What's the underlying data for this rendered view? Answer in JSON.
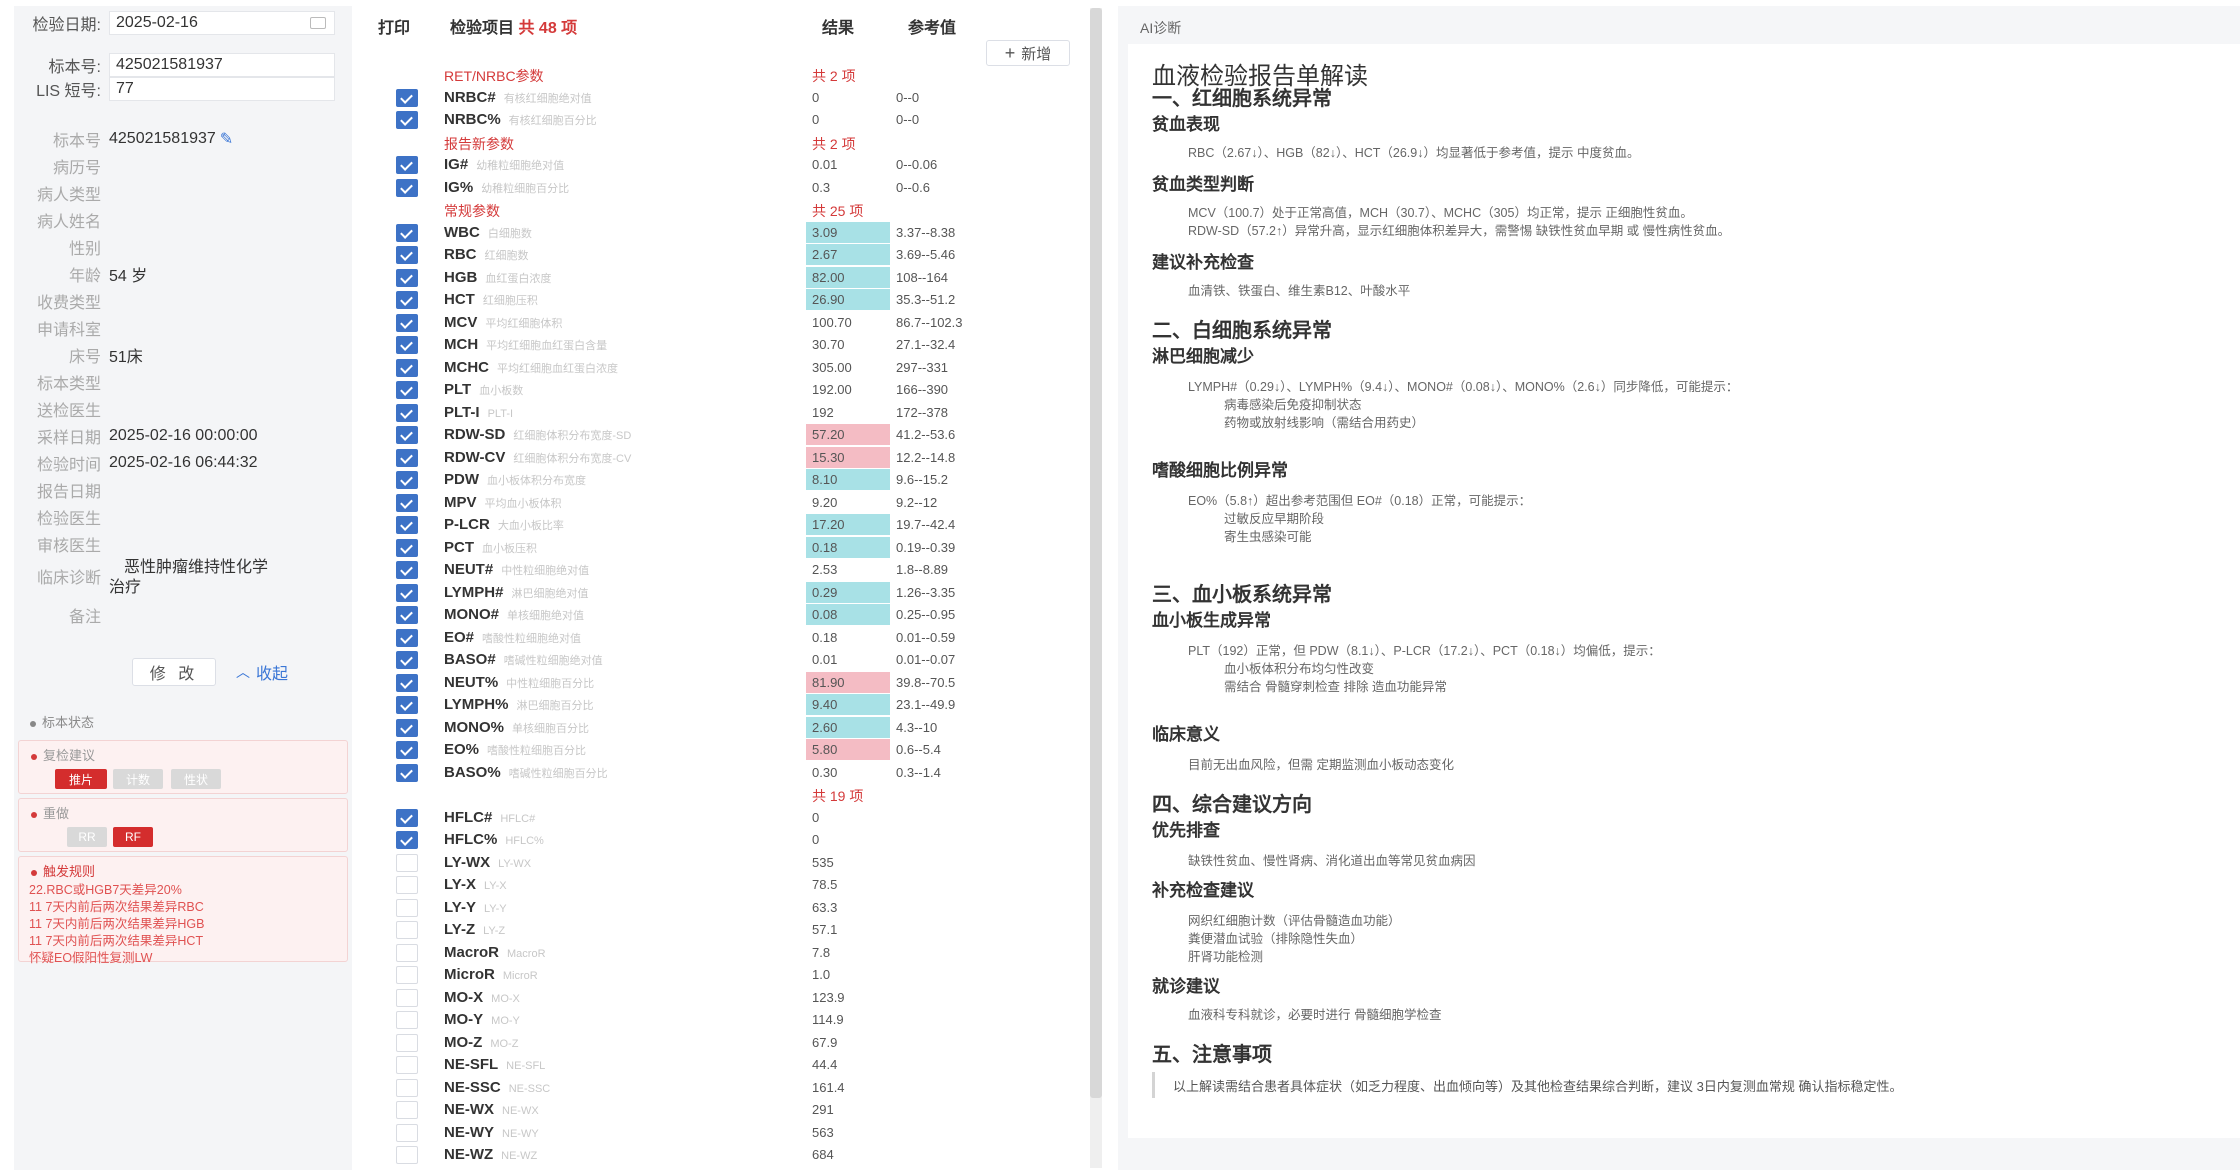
{
  "left": {
    "date_label": "检验日期:",
    "date_value": "2025-02-16",
    "sample_label": "标本号:",
    "sample_value": "425021581937",
    "lis_label": "LIS 短号:",
    "lis_value": "77",
    "info": [
      {
        "k": "标本号",
        "v": "425021581937",
        "pencil": true
      },
      {
        "k": "病历号",
        "v": ""
      },
      {
        "k": "病人类型",
        "v": ""
      },
      {
        "k": "病人姓名",
        "v": ""
      },
      {
        "k": "性别",
        "v": ""
      },
      {
        "k": "年龄",
        "v": "54 岁"
      },
      {
        "k": "收费类型",
        "v": ""
      },
      {
        "k": "申请科室",
        "v": ""
      },
      {
        "k": "床号",
        "v": "51床"
      },
      {
        "k": "标本类型",
        "v": ""
      },
      {
        "k": "送检医生",
        "v": ""
      },
      {
        "k": "采样日期",
        "v": "2025-02-16 00:00:00"
      },
      {
        "k": "检验时间",
        "v": "2025-02-16 06:44:32"
      },
      {
        "k": "报告日期",
        "v": ""
      },
      {
        "k": "检验医生",
        "v": ""
      },
      {
        "k": "审核医生",
        "v": ""
      }
    ],
    "diagnosis_label": "临床诊断",
    "diagnosis_value_1": "恶性肿瘤维持性化学",
    "diagnosis_value_2": "治疗",
    "remark_label": "备注",
    "edit_label": "修 改",
    "collapse_label": "收起",
    "status_title": "标本状态",
    "recheck_title": "复检建议",
    "recheck_tags": [
      "推片",
      "计数",
      "性状"
    ],
    "alarm_title": "重做",
    "alarm_tags": [
      "RR",
      "RF"
    ],
    "rule_title": "触发规则",
    "rules": [
      "22.RBC或HGB7天差异20%",
      "11 7天内前后两次结果差异RBC",
      "11 7天内前后两次结果差异HGB",
      "11 7天内前后两次结果差异HCT",
      "怀疑EO假阳性复测LW"
    ]
  },
  "middle": {
    "col_print": "打印",
    "col_item": "检验项目",
    "item_total": "共 48 项",
    "col_result": "结果",
    "col_ref": "参考值",
    "add_label": "新增",
    "rows": [
      {
        "type": "group",
        "name": "RET/NRBC参数",
        "count": "共 2 项"
      },
      {
        "code": "NRBC#",
        "cname": "有核红细胞绝对值",
        "res": "0",
        "ref": "0--0",
        "flag": "",
        "on": true
      },
      {
        "code": "NRBC%",
        "cname": "有核红细胞百分比",
        "res": "0",
        "ref": "0--0",
        "flag": "",
        "on": true
      },
      {
        "type": "group",
        "name": "报告新参数",
        "count": "共 2 项"
      },
      {
        "code": "IG#",
        "cname": "幼稚粒细胞绝对值",
        "res": "0.01",
        "ref": "0--0.06",
        "flag": "",
        "on": true
      },
      {
        "code": "IG%",
        "cname": "幼稚粒细胞百分比",
        "res": "0.3",
        "ref": "0--0.6",
        "flag": "",
        "on": true
      },
      {
        "type": "group",
        "name": "常规参数",
        "count": "共 25 项"
      },
      {
        "code": "WBC",
        "cname": "白细胞数",
        "res": "3.09",
        "ref": "3.37--8.38",
        "flag": "low",
        "on": true
      },
      {
        "code": "RBC",
        "cname": "红细胞数",
        "res": "2.67",
        "ref": "3.69--5.46",
        "flag": "low",
        "on": true
      },
      {
        "code": "HGB",
        "cname": "血红蛋白浓度",
        "res": "82.00",
        "ref": "108--164",
        "flag": "low",
        "on": true
      },
      {
        "code": "HCT",
        "cname": "红细胞压积",
        "res": "26.90",
        "ref": "35.3--51.2",
        "flag": "low",
        "on": true
      },
      {
        "code": "MCV",
        "cname": "平均红细胞体积",
        "res": "100.70",
        "ref": "86.7--102.3",
        "flag": "",
        "on": true
      },
      {
        "code": "MCH",
        "cname": "平均红细胞血红蛋白含量",
        "res": "30.70",
        "ref": "27.1--32.4",
        "flag": "",
        "on": true
      },
      {
        "code": "MCHC",
        "cname": "平均红细胞血红蛋白浓度",
        "res": "305.00",
        "ref": "297--331",
        "flag": "",
        "on": true
      },
      {
        "code": "PLT",
        "cname": "血小板数",
        "res": "192.00",
        "ref": "166--390",
        "flag": "",
        "on": true
      },
      {
        "code": "PLT-I",
        "cname": "PLT-I",
        "res": "192",
        "ref": "172--378",
        "flag": "",
        "on": true
      },
      {
        "code": "RDW-SD",
        "cname": "红细胞体积分布宽度-SD",
        "res": "57.20",
        "ref": "41.2--53.6",
        "flag": "high",
        "on": true
      },
      {
        "code": "RDW-CV",
        "cname": "红细胞体积分布宽度-CV",
        "res": "15.30",
        "ref": "12.2--14.8",
        "flag": "high",
        "on": true
      },
      {
        "code": "PDW",
        "cname": "血小板体积分布宽度",
        "res": "8.10",
        "ref": "9.6--15.2",
        "flag": "low",
        "on": true
      },
      {
        "code": "MPV",
        "cname": "平均血小板体积",
        "res": "9.20",
        "ref": "9.2--12",
        "flag": "",
        "on": true
      },
      {
        "code": "P-LCR",
        "cname": "大血小板比率",
        "res": "17.20",
        "ref": "19.7--42.4",
        "flag": "low",
        "on": true
      },
      {
        "code": "PCT",
        "cname": "血小板压积",
        "res": "0.18",
        "ref": "0.19--0.39",
        "flag": "low",
        "on": true
      },
      {
        "code": "NEUT#",
        "cname": "中性粒细胞绝对值",
        "res": "2.53",
        "ref": "1.8--8.89",
        "flag": "",
        "on": true
      },
      {
        "code": "LYMPH#",
        "cname": "淋巴细胞绝对值",
        "res": "0.29",
        "ref": "1.26--3.35",
        "flag": "low",
        "on": true
      },
      {
        "code": "MONO#",
        "cname": "单核细胞绝对值",
        "res": "0.08",
        "ref": "0.25--0.95",
        "flag": "low",
        "on": true
      },
      {
        "code": "EO#",
        "cname": "嗜酸性粒细胞绝对值",
        "res": "0.18",
        "ref": "0.01--0.59",
        "flag": "",
        "on": true
      },
      {
        "code": "BASO#",
        "cname": "嗜碱性粒细胞绝对值",
        "res": "0.01",
        "ref": "0.01--0.07",
        "flag": "",
        "on": true
      },
      {
        "code": "NEUT%",
        "cname": "中性粒细胞百分比",
        "res": "81.90",
        "ref": "39.8--70.5",
        "flag": "high",
        "on": true
      },
      {
        "code": "LYMPH%",
        "cname": "淋巴细胞百分比",
        "res": "9.40",
        "ref": "23.1--49.9",
        "flag": "low",
        "on": true
      },
      {
        "code": "MONO%",
        "cname": "单核细胞百分比",
        "res": "2.60",
        "ref": "4.3--10",
        "flag": "low",
        "on": true
      },
      {
        "code": "EO%",
        "cname": "嗜酸性粒细胞百分比",
        "res": "5.80",
        "ref": "0.6--5.4",
        "flag": "high",
        "on": true
      },
      {
        "code": "BASO%",
        "cname": "嗜碱性粒细胞百分比",
        "res": "0.30",
        "ref": "0.3--1.4",
        "flag": "",
        "on": true
      },
      {
        "type": "group",
        "name": "",
        "count": "共 19 项"
      },
      {
        "code": "HFLC#",
        "cname": "HFLC#",
        "res": "0",
        "ref": "",
        "flag": "",
        "on": true
      },
      {
        "code": "HFLC%",
        "cname": "HFLC%",
        "res": "0",
        "ref": "",
        "flag": "",
        "on": true
      },
      {
        "code": "LY-WX",
        "cname": "LY-WX",
        "res": "535",
        "ref": "",
        "flag": "",
        "on": false
      },
      {
        "code": "LY-X",
        "cname": "LY-X",
        "res": "78.5",
        "ref": "",
        "flag": "",
        "on": false
      },
      {
        "code": "LY-Y",
        "cname": "LY-Y",
        "res": "63.3",
        "ref": "",
        "flag": "",
        "on": false
      },
      {
        "code": "LY-Z",
        "cname": "LY-Z",
        "res": "57.1",
        "ref": "",
        "flag": "",
        "on": false
      },
      {
        "code": "MacroR",
        "cname": "MacroR",
        "res": "7.8",
        "ref": "",
        "flag": "",
        "on": false
      },
      {
        "code": "MicroR",
        "cname": "MicroR",
        "res": "1.0",
        "ref": "",
        "flag": "",
        "on": false
      },
      {
        "code": "MO-X",
        "cname": "MO-X",
        "res": "123.9",
        "ref": "",
        "flag": "",
        "on": false
      },
      {
        "code": "MO-Y",
        "cname": "MO-Y",
        "res": "114.9",
        "ref": "",
        "flag": "",
        "on": false
      },
      {
        "code": "MO-Z",
        "cname": "MO-Z",
        "res": "67.9",
        "ref": "",
        "flag": "",
        "on": false
      },
      {
        "code": "NE-SFL",
        "cname": "NE-SFL",
        "res": "44.4",
        "ref": "",
        "flag": "",
        "on": false
      },
      {
        "code": "NE-SSC",
        "cname": "NE-SSC",
        "res": "161.4",
        "ref": "",
        "flag": "",
        "on": false
      },
      {
        "code": "NE-WX",
        "cname": "NE-WX",
        "res": "291",
        "ref": "",
        "flag": "",
        "on": false
      },
      {
        "code": "NE-WY",
        "cname": "NE-WY",
        "res": "563",
        "ref": "",
        "flag": "",
        "on": false
      },
      {
        "code": "NE-WZ",
        "cname": "NE-WZ",
        "res": "684",
        "ref": "",
        "flag": "",
        "on": false
      }
    ]
  },
  "ai": {
    "label": "AI诊断",
    "title": "血液检验报告单解读",
    "s1": "一、红细胞系统异常",
    "s1_h1": "贫血表现",
    "s1_p1": "RBC（2.67↓）、HGB（82↓）、HCT（26.9↓）均显著低于参考值，提示 中度贫血。",
    "s1_h2": "贫血类型判断",
    "s1_p2a": "MCV（100.7）处于正常高值，MCH（30.7）、MCHC（305）均正常，提示 正细胞性贫血。",
    "s1_p2b": "RDW-SD（57.2↑）异常升高，显示红细胞体积差异大，需警惕 缺铁性贫血早期 或 慢性病性贫血。",
    "s1_h3": "建议补充检查",
    "s1_p3": "血清铁、铁蛋白、维生素B12、叶酸水平",
    "s2": "二、白细胞系统异常",
    "s2_h1": "淋巴细胞减少",
    "s2_p1": "LYMPH#（0.29↓）、LYMPH%（9.4↓）、MONO#（0.08↓）、MONO%（2.6↓）同步降低，可能提示：",
    "s2_p1a": "病毒感染后免疫抑制状态",
    "s2_p1b": "药物或放射线影响（需结合用药史）",
    "s2_h2": "嗜酸细胞比例异常",
    "s2_p2": "EO%（5.8↑）超出参考范围但 EO#（0.18）正常，可能提示：",
    "s2_p2a": "过敏反应早期阶段",
    "s2_p2b": "寄生虫感染可能",
    "s3": "三、血小板系统异常",
    "s3_h1": "血小板生成异常",
    "s3_p1": "PLT（192）正常，但 PDW（8.1↓）、P-LCR（17.2↓）、PCT（0.18↓）均偏低，提示：",
    "s3_p1a": "血小板体积分布均匀性改变",
    "s3_p1b": "需结合 骨髓穿刺检查 排除 造血功能异常",
    "s3_h2": "临床意义",
    "s3_p2": "目前无出血风险，但需 定期监测血小板动态变化",
    "s4": "四、综合建议方向",
    "s4_h1": "优先排查",
    "s4_p1": "缺铁性贫血、慢性肾病、消化道出血等常见贫血病因",
    "s4_h2": "补充检查建议",
    "s4_p2a": "网织红细胞计数（评估骨髓造血功能）",
    "s4_p2b": "粪便潜血试验（排除隐性失血）",
    "s4_p2c": "肝肾功能检测",
    "s4_h3": "就诊建议",
    "s4_p3": "血液科专科就诊，必要时进行 骨髓细胞学检查",
    "s5": "五、注意事项",
    "s5_p": "以上解读需结合患者具体症状（如乏力程度、出血倾向等）及其他检查结果综合判断，建议 3日内复测血常规 确认指标稳定性。"
  }
}
